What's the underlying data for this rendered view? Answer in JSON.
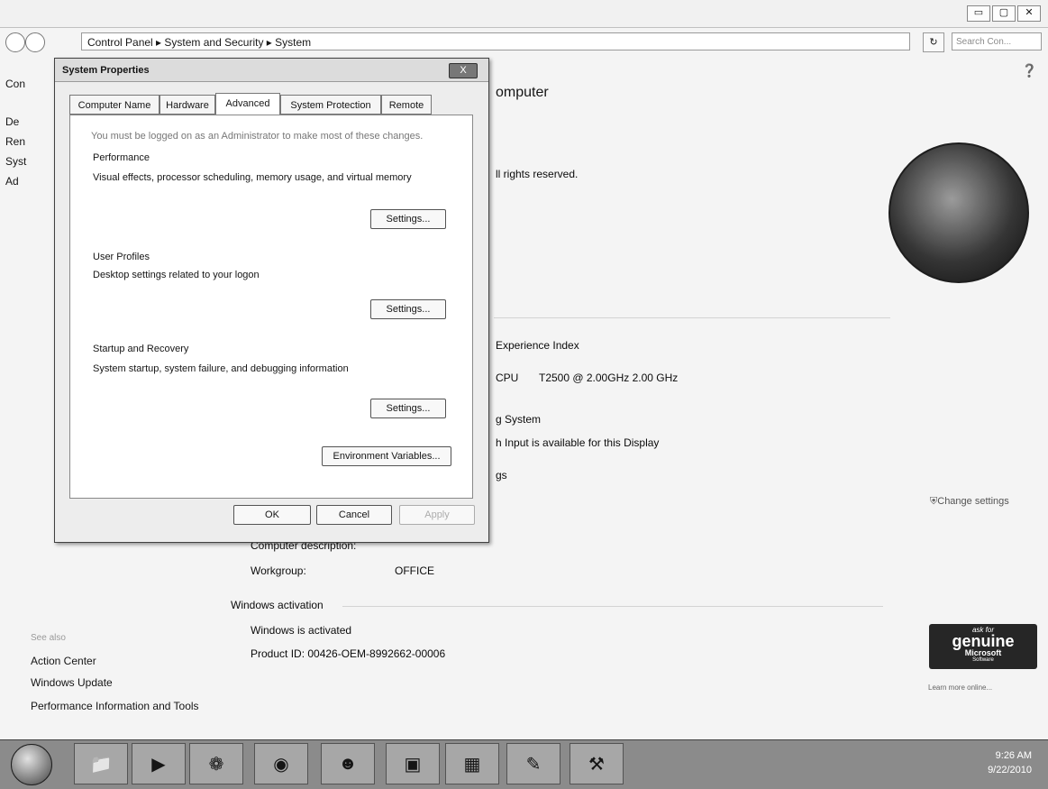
{
  "explorer": {
    "breadcrumb": "Control Panel  ▸  System and Security  ▸  System",
    "search_placeholder": "Search Con...",
    "left_nav_partial": [
      "Con",
      "De",
      "Ren",
      "Syst",
      "Ad"
    ],
    "see_also": "See also",
    "see_also_links": [
      "Action Center",
      "Windows Update",
      "Performance Information and Tools"
    ],
    "main_title_partial": "omputer",
    "rights": "ll rights reserved.",
    "experience_index": "Experience Index",
    "cpu_label": "CPU",
    "cpu_value": "T2500  @ 2.00GHz  2.00 GHz",
    "system_type_partial": "g System",
    "pen_touch_partial": "h Input is available for this Display",
    "settings_partial": "gs",
    "change_settings": "Change settings",
    "computer_description_label": "Computer description:",
    "workgroup_label": "Workgroup:",
    "workgroup_value": "OFFICE",
    "activation_heading": "Windows activation",
    "activation_status": "Windows is activated",
    "product_id": "Product ID:  00426-OEM-8992662-00006",
    "genuine_line1": "ask for",
    "genuine_line2": "genuine",
    "genuine_line3": "Microsoft",
    "genuine_line4": "Software",
    "learn_more": "Learn more online..."
  },
  "dialog": {
    "title": "System Properties",
    "close": "X",
    "tabs": [
      "Computer Name",
      "Hardware",
      "Advanced",
      "System Protection",
      "Remote"
    ],
    "intro_partial": "You must be logged on as an Administrator to make most of these changes.",
    "performance_heading": "Performance",
    "performance_desc": "Visual effects, processor scheduling, memory usage, and virtual memory",
    "settings_label": "Settings...",
    "user_profiles_heading": "User Profiles",
    "user_profiles_desc": "Desktop settings related to your logon",
    "startup_heading": "Startup and Recovery",
    "startup_desc": "System startup, system failure, and debugging information",
    "env_vars": "Environment Variables...",
    "ok": "OK",
    "cancel": "Cancel",
    "apply": "Apply"
  },
  "taskbar": {
    "time": "9:26 AM",
    "date": "9/22/2010"
  }
}
